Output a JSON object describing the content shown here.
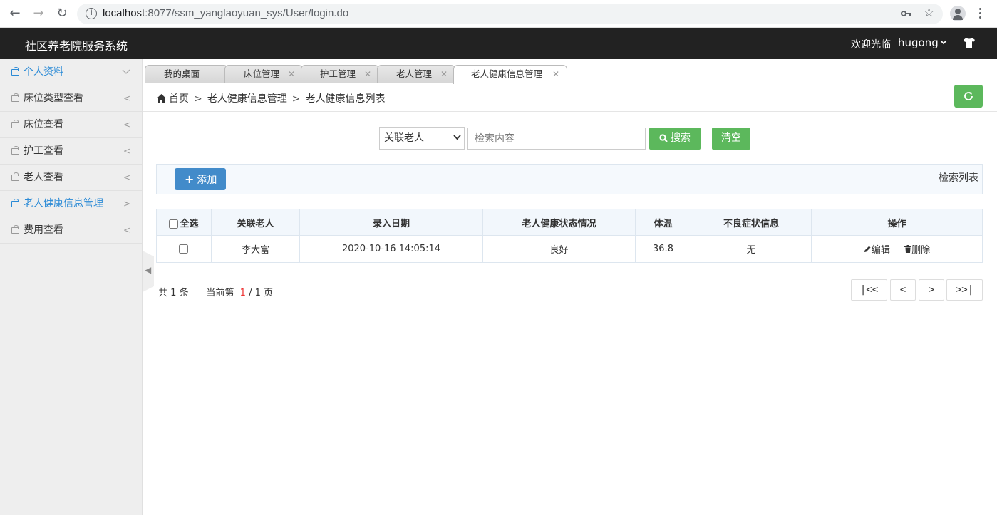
{
  "browser": {
    "url_host": "localhost",
    "url_path": ":8077/ssm_yanglaoyuan_sys/User/login.do"
  },
  "header": {
    "title": "社区养老院服务系统",
    "welcome": "欢迎光临",
    "username": "hugong"
  },
  "sidebar": {
    "items": [
      {
        "label": "个人资料"
      },
      {
        "label": "床位类型查看"
      },
      {
        "label": "床位查看"
      },
      {
        "label": "护工查看"
      },
      {
        "label": "老人查看"
      },
      {
        "label": "老人健康信息管理"
      },
      {
        "label": "费用查看"
      }
    ]
  },
  "tabs": [
    {
      "label": "我的桌面"
    },
    {
      "label": "床位管理"
    },
    {
      "label": "护工管理"
    },
    {
      "label": "老人管理"
    },
    {
      "label": "老人健康信息管理"
    }
  ],
  "breadcrumb": {
    "home": "首页",
    "level1": "老人健康信息管理",
    "level2": "老人健康信息列表"
  },
  "search": {
    "select_value": "关联老人",
    "placeholder": "检索内容",
    "search_label": "搜索",
    "clear_label": "清空"
  },
  "toolbar": {
    "add_label": "添加",
    "caption": "检索列表"
  },
  "table": {
    "headers": {
      "select_all": "全选",
      "elder": "关联老人",
      "date": "录入日期",
      "status": "老人健康状态情况",
      "temp": "体温",
      "symptom": "不良症状信息",
      "ops": "操作"
    },
    "rows": [
      {
        "elder": "李大富",
        "date": "2020-10-16 14:05:14",
        "status": "良好",
        "temp": "36.8",
        "symptom": "无",
        "edit": "编辑",
        "delete": "删除"
      }
    ]
  },
  "pagination": {
    "total_prefix": "共",
    "total": "1",
    "total_suffix": "条",
    "current_prefix": "当前第",
    "current": "1",
    "pages": "/ 1 页",
    "first": "|<<",
    "prev": "<",
    "next": ">",
    "last": ">>|"
  }
}
